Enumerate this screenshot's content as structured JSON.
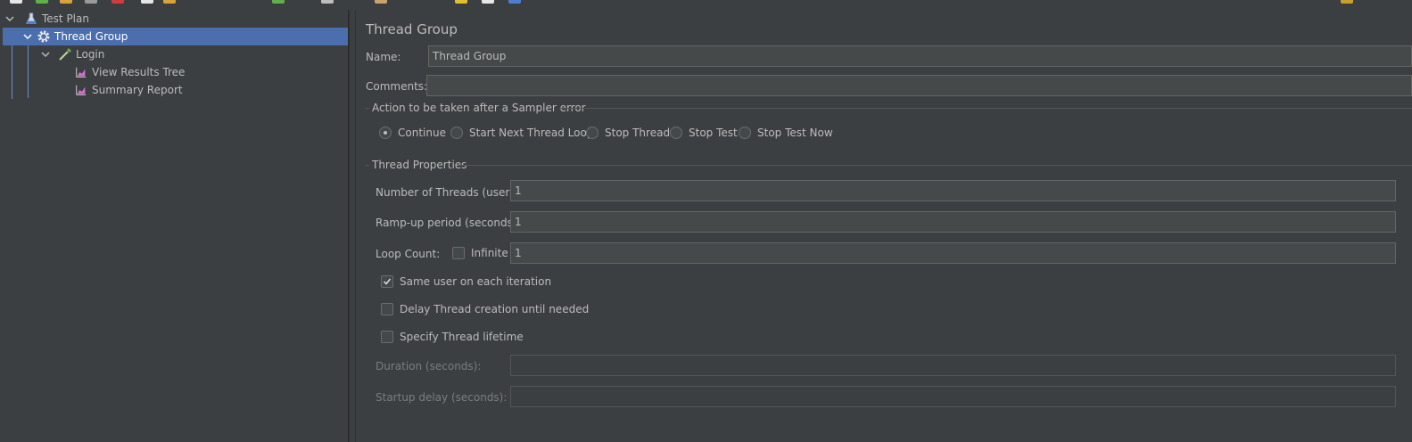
{
  "tree": {
    "items": [
      {
        "label": "Test Plan",
        "icon": "flask-icon"
      },
      {
        "label": "Thread Group",
        "icon": "gear-icon"
      },
      {
        "label": "Login",
        "icon": "pipette-icon"
      },
      {
        "label": "View Results Tree",
        "icon": "graph-icon"
      },
      {
        "label": "Summary Report",
        "icon": "graph-icon"
      }
    ],
    "selected": "Thread Group"
  },
  "panel": {
    "title": "Thread Group",
    "name_label": "Name:",
    "name_value": "Thread Group",
    "comments_label": "Comments:",
    "comments_value": "",
    "sampler_error": {
      "legend": "Action to be taken after a Sampler error",
      "options": [
        "Continue",
        "Start Next Thread Loop",
        "Stop Thread",
        "Stop Test",
        "Stop Test Now"
      ],
      "selected": "Continue"
    },
    "thread_props": {
      "legend": "Thread Properties",
      "threads_label": "Number of Threads (users):",
      "threads_value": "1",
      "rampup_label": "Ramp-up period (seconds):",
      "rampup_value": "1",
      "loop_label": "Loop Count:",
      "infinite_label": "Infinite",
      "infinite_checked": false,
      "loop_value": "1",
      "same_user_label": "Same user on each iteration",
      "same_user_checked": true,
      "delay_label": "Delay Thread creation until needed",
      "delay_checked": false,
      "lifetime_label": "Specify Thread lifetime",
      "lifetime_checked": false,
      "duration_label": "Duration (seconds):",
      "duration_value": "",
      "startup_label": "Startup delay (seconds):",
      "startup_value": ""
    }
  },
  "colors": {
    "background": "#3c3f41",
    "selection": "#4b6eaf",
    "field": "#45494a",
    "text": "#bbbbbb"
  }
}
